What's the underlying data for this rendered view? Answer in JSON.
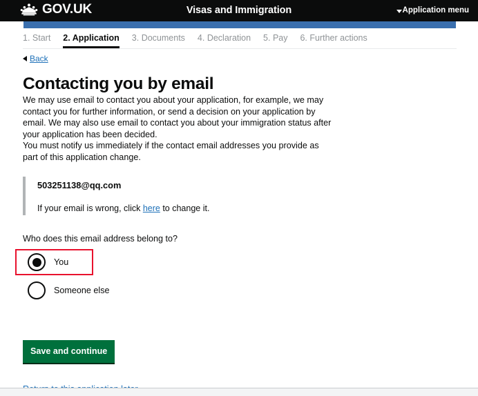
{
  "header": {
    "brand": "GOV.UK",
    "crown_icon": "crown-icon",
    "service_title": "Visas and Immigration",
    "menu_label": "Application menu",
    "menu_caret_icon": "caret-down-icon",
    "background_color": "#0b0c0c"
  },
  "progress_bar": {
    "color": "#3a6fae"
  },
  "steps": [
    {
      "label": "1. Start",
      "active": false
    },
    {
      "label": "2. Application",
      "active": true
    },
    {
      "label": "3. Documents",
      "active": false
    },
    {
      "label": "4. Declaration",
      "active": false
    },
    {
      "label": "5. Pay",
      "active": false
    },
    {
      "label": "6. Further actions",
      "active": false
    }
  ],
  "back": {
    "label": "Back",
    "arrow_icon": "back-arrow-icon"
  },
  "main": {
    "title": "Contacting you by email",
    "paragraph_1": "We may use email to contact you about your application, for example, we may contact you for further information, or send a decision on your application by email. We may also use email to contact you about your immigration status after your application has been decided.",
    "paragraph_2": "You must notify us immediately if the contact email addresses you provide as part of this application change.",
    "email_panel": {
      "email": "503251138@qq.com",
      "help_prefix": "If your email is wrong, click ",
      "help_link": "here",
      "help_suffix": " to change it."
    },
    "radio_question": "Who does this email address belong to?",
    "radio_options": [
      {
        "label": "You",
        "selected": true
      },
      {
        "label": "Someone else",
        "selected": false
      }
    ],
    "highlight_color": "#e8112d",
    "save_label": "Save and continue",
    "save_color": "#00703c",
    "return_link": "Return to this application later"
  }
}
